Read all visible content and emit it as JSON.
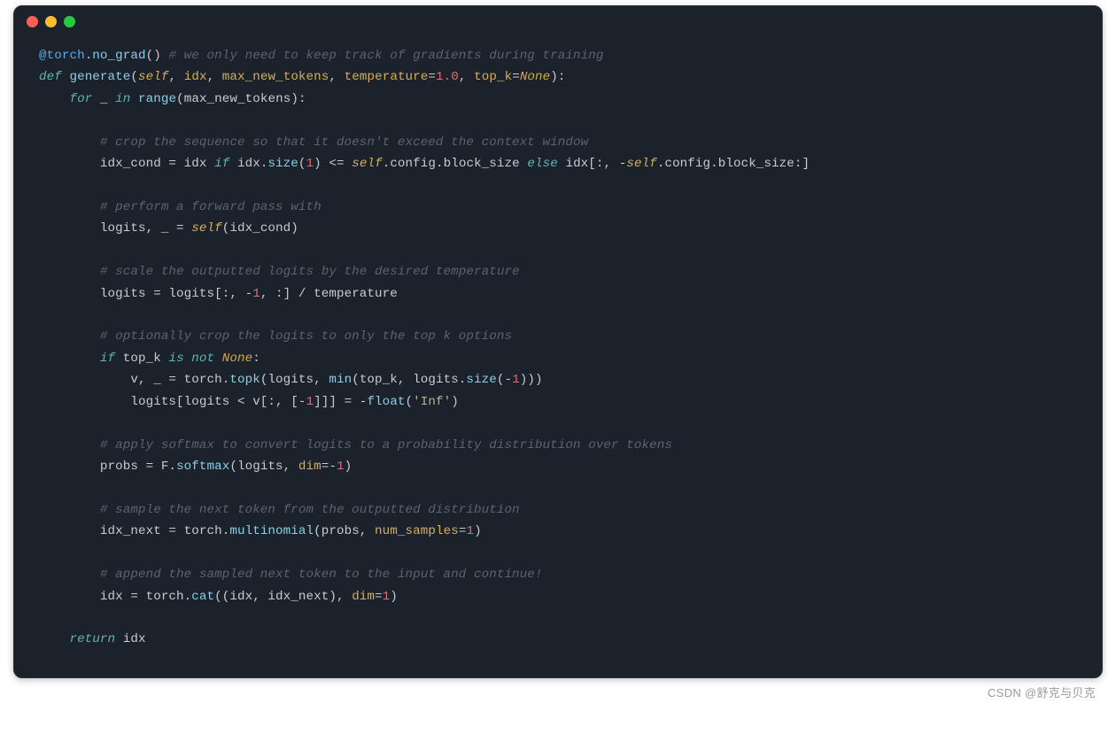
{
  "window": {
    "dots": [
      "red",
      "yellow",
      "green"
    ]
  },
  "code": {
    "l01_at": "@torch",
    "l01_deco": ".no_grad",
    "l01_paren": "()",
    "l01_comm": " # we only need to keep track of gradients during training",
    "l02_def": "def ",
    "l02_fn": "generate",
    "l02_open": "(",
    "l02_self": "self",
    "l02_c1": ", ",
    "l02_p1": "idx",
    "l02_c2": ", ",
    "l02_p2": "max_new_tokens",
    "l02_c3": ", ",
    "l02_p3": "temperature",
    "l02_eq1": "=",
    "l02_v1": "1.0",
    "l02_c4": ", ",
    "l02_p4": "top_k",
    "l02_eq2": "=",
    "l02_v2": "None",
    "l02_close": "):",
    "l03_for": "    for ",
    "l03_u": "_",
    "l03_in": " in ",
    "l03_range": "range",
    "l03_open": "(",
    "l03_arg": "max_new_tokens",
    "l03_close": "):",
    "l05_comm": "        # crop the sequence so that it doesn't exceed the context window",
    "l06_a": "        idx_cond = idx ",
    "l06_if": "if",
    "l06_b": " idx.",
    "l06_size": "size",
    "l06_c": "(",
    "l06_num1": "1",
    "l06_d": ") <= ",
    "l06_self": "self",
    "l06_e": ".config.block_size ",
    "l06_else": "else",
    "l06_f": " idx[:, -",
    "l06_self2": "self",
    "l06_g": ".config.block_size:]",
    "l08_comm": "        # perform a forward pass with",
    "l09_a": "        logits, _ = ",
    "l09_self": "self",
    "l09_b": "(idx_cond)",
    "l11_comm": "        # scale the outputted logits by the desired temperature",
    "l12_a": "        logits = logits[:, -",
    "l12_num": "1",
    "l12_b": ", :] / temperature",
    "l14_comm": "        # optionally crop the logits to only the top k options",
    "l15_if": "        if ",
    "l15_var": "top_k",
    "l15_isnot": " is not ",
    "l15_none": "None",
    "l15_colon": ":",
    "l16_a": "            v, _ = torch.",
    "l16_topk": "topk",
    "l16_b": "(logits, ",
    "l16_min": "min",
    "l16_c": "(top_k, logits.",
    "l16_size": "size",
    "l16_d": "(-",
    "l16_num": "1",
    "l16_e": ")))",
    "l17_a": "            logits[logits < v[:, [-",
    "l17_num": "1",
    "l17_b": "]]] = -",
    "l17_float": "float",
    "l17_c": "(",
    "l17_str": "'Inf'",
    "l17_d": ")",
    "l19_comm": "        # apply softmax to convert logits to a probability distribution over tokens",
    "l20_a": "        probs = F.",
    "l20_sm": "softmax",
    "l20_b": "(logits, ",
    "l20_dim": "dim",
    "l20_c": "=-",
    "l20_num": "1",
    "l20_d": ")",
    "l22_comm": "        # sample the next token from the outputted distribution",
    "l23_a": "        idx_next = torch.",
    "l23_mn": "multinomial",
    "l23_b": "(probs, ",
    "l23_ns": "num_samples",
    "l23_c": "=",
    "l23_num": "1",
    "l23_d": ")",
    "l25_comm": "        # append the sampled next token to the input and continue!",
    "l26_a": "        idx = torch.",
    "l26_cat": "cat",
    "l26_b": "((idx, idx_next), ",
    "l26_dim": "dim",
    "l26_c": "=",
    "l26_num": "1",
    "l26_d": ")",
    "l28_ret": "    return ",
    "l28_var": "idx"
  },
  "watermark": "CSDN @舒克与贝克"
}
